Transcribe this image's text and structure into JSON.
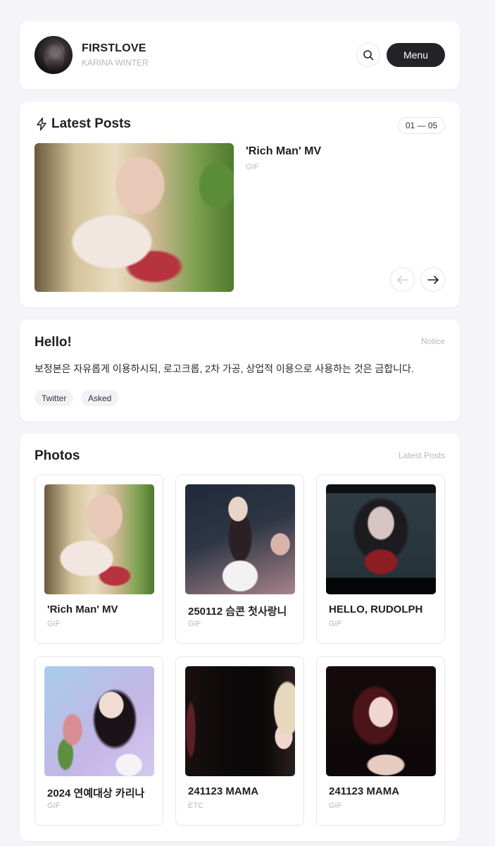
{
  "header": {
    "site_title": "FIRSTLOVE",
    "site_subtitle": "KARINA WINTER",
    "menu_label": "Menu",
    "avatar_icon": "avatar-photo",
    "search_icon": "magnifier"
  },
  "latest_posts": {
    "title": "Latest Posts",
    "range": "01 — 05",
    "featured": {
      "title": "'Rich Man' MV",
      "type": "GIF"
    },
    "prev_icon": "arrow-left",
    "next_icon": "arrow-right",
    "title_icon": "lightning-bolt"
  },
  "notice": {
    "title": "Hello!",
    "label": "Notice",
    "body": "보정본은 자유롭게 이용하시되, 로고크롭, 2차 가공, 상업적 이용으로 사용하는 것은 금합니다.",
    "tags": [
      "Twitter",
      "Asked"
    ]
  },
  "photos": {
    "title": "Photos",
    "link": "Latest Posts",
    "items": [
      {
        "title": "'Rich Man' MV",
        "type": "GIF"
      },
      {
        "title": "250112 슴콘 첫사랑니",
        "type": "GIF"
      },
      {
        "title": "HELLO, RUDOLPH",
        "type": "GIF"
      },
      {
        "title": "2024 연예대상 카리나",
        "type": "GIF"
      },
      {
        "title": "241123 MAMA",
        "type": "ETC"
      },
      {
        "title": "241123 MAMA",
        "type": "GIF"
      }
    ]
  },
  "colors": {
    "background": "#f4f4f9",
    "card": "#ffffff",
    "primary_button": "#232327",
    "muted_text": "#b5b5c3"
  }
}
